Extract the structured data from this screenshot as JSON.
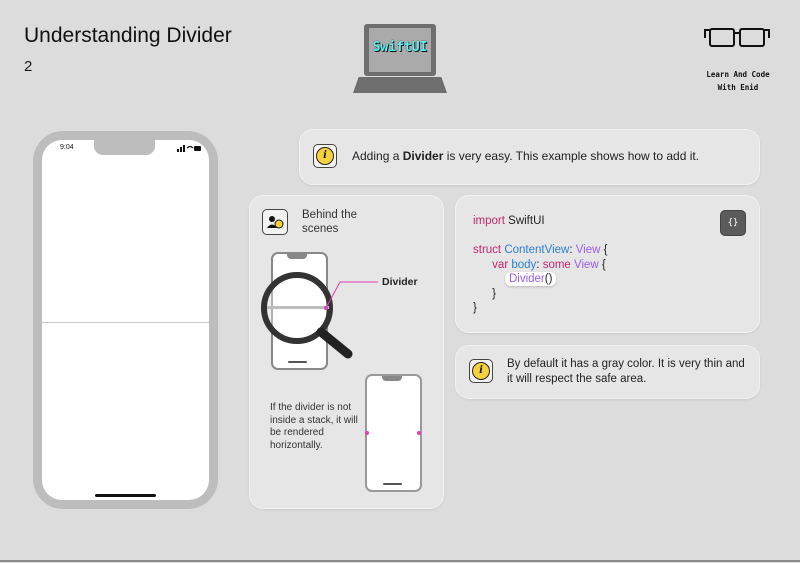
{
  "header": {
    "title": "Understanding Divider",
    "page_number": "2"
  },
  "logo": {
    "laptop_text": "SwiftUI",
    "brand_line1": "Learn And Code",
    "brand_line2": "With Enid"
  },
  "phone": {
    "time": "9:04",
    "status_icons": "··· ◉ ▬"
  },
  "intro": {
    "text_before": "Adding a ",
    "text_bold": "Divider",
    "text_after": " is very easy. This example shows how to add it.",
    "icon": "info-icon"
  },
  "scenes": {
    "label": "Behind the scenes",
    "divider_label": "Divider",
    "footnote": "If the divider is not inside a stack, it will be rendered horizontally."
  },
  "code": {
    "import_kw": "import",
    "import_name": " SwiftUI",
    "struct_kw": "struct",
    "struct_name": "ContentView",
    "colon": ": ",
    "protocol": "View",
    "open1": " {",
    "var_kw": "var",
    "var_name": "body",
    "colon2": ": ",
    "some_kw": "some",
    "view_type": "View",
    "open2": " {",
    "divider_call": "Divider",
    "parens": "()",
    "close1": "}",
    "close2": "}",
    "icon_label": "{}"
  },
  "note": {
    "text": "By default it has a gray color. It is very thin and it will respect the safe area.",
    "icon": "info-icon"
  },
  "colors": {
    "keyword": "#c3266e",
    "type": "#2a7fd1",
    "purple": "#9b5cf0",
    "info": "#f5d23d",
    "accent_line": "#e040b0"
  }
}
